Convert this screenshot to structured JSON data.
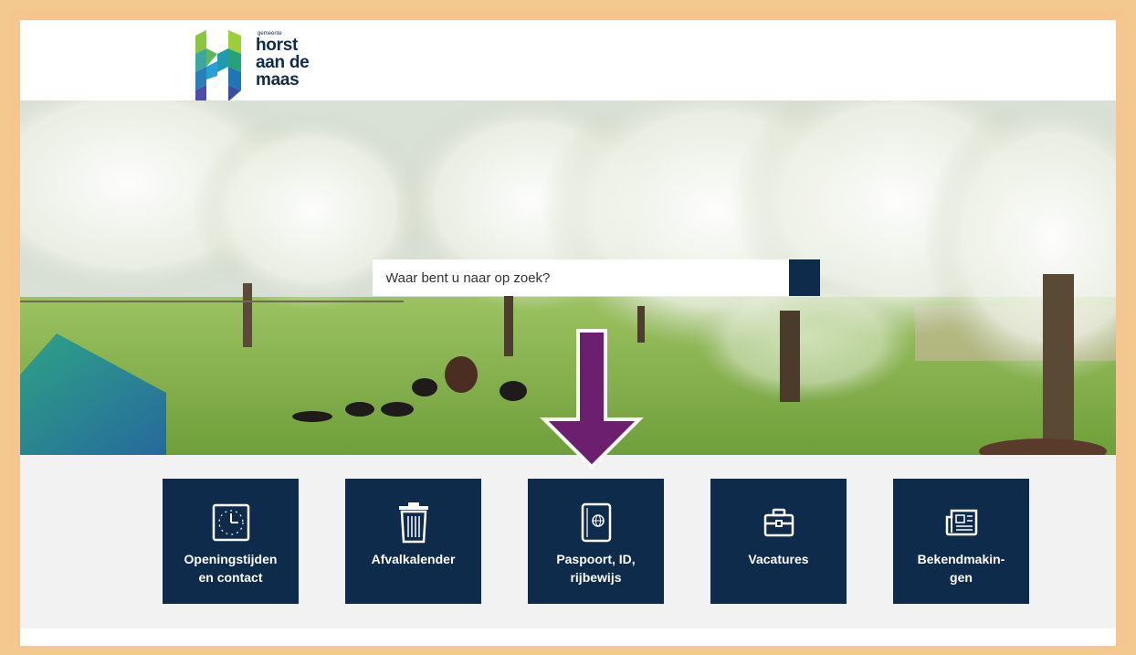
{
  "logo": {
    "small": "gemeente",
    "lines": [
      "horst",
      "aan de",
      "maas"
    ]
  },
  "search": {
    "placeholder": "Waar bent u naar op zoek?",
    "button_icon": "search-icon"
  },
  "tiles": [
    {
      "label": "Openingstijden\nen contact",
      "icon": "clock-icon"
    },
    {
      "label": "Afvalkalender",
      "icon": "trash-bin-icon"
    },
    {
      "label": "Paspoort, ID,\nrijbewijs",
      "icon": "passport-icon"
    },
    {
      "label": "Vacatures",
      "icon": "briefcase-icon"
    },
    {
      "label": "Bekendmakin-\ngen",
      "icon": "newspaper-icon"
    }
  ],
  "annotation": {
    "arrow_color": "#6b1f6e",
    "points_to": "Paspoort, ID, rijbewijs"
  },
  "colors": {
    "brand_navy": "#0f2b4c",
    "frame": "#f5c690",
    "tile_area_bg": "#f2f2f2"
  }
}
